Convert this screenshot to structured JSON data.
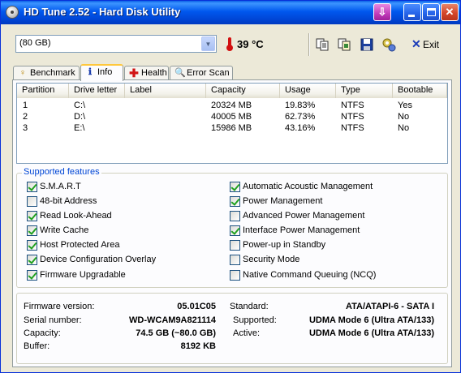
{
  "window": {
    "title": "HD Tune 2.52 - Hard Disk Utility"
  },
  "toolbar": {
    "drive_value": "(80 GB)",
    "temperature": "39 °C",
    "exit_label": "Exit",
    "icons": [
      "copy-text-icon",
      "copy-screenshot-icon",
      "save-icon",
      "options-icon",
      "exit-icon"
    ]
  },
  "tabs": [
    {
      "label": "Benchmark",
      "icon": "benchmark-icon"
    },
    {
      "label": "Info",
      "icon": "info-icon",
      "active": true
    },
    {
      "label": "Health",
      "icon": "health-icon"
    },
    {
      "label": "Error Scan",
      "icon": "error-scan-icon"
    }
  ],
  "partitions": {
    "headers": [
      "Partition",
      "Drive letter",
      "Label",
      "Capacity",
      "Usage",
      "Type",
      "Bootable"
    ],
    "rows": [
      {
        "partition": "1",
        "drive": "C:\\",
        "label": "",
        "capacity": "20324 MB",
        "usage": "19.83%",
        "type": "NTFS",
        "bootable": "Yes"
      },
      {
        "partition": "2",
        "drive": "D:\\",
        "label": "",
        "capacity": "40005 MB",
        "usage": "62.73%",
        "type": "NTFS",
        "bootable": "No"
      },
      {
        "partition": "3",
        "drive": "E:\\",
        "label": "",
        "capacity": "15986 MB",
        "usage": "43.16%",
        "type": "NTFS",
        "bootable": "No"
      }
    ]
  },
  "features": {
    "title": "Supported features",
    "left": [
      {
        "label": "S.M.A.R.T",
        "checked": true
      },
      {
        "label": "48-bit Address",
        "checked": false
      },
      {
        "label": "Read Look-Ahead",
        "checked": true
      },
      {
        "label": "Write Cache",
        "checked": true
      },
      {
        "label": "Host Protected Area",
        "checked": true
      },
      {
        "label": "Device Configuration Overlay",
        "checked": true
      },
      {
        "label": "Firmware Upgradable",
        "checked": true
      }
    ],
    "right": [
      {
        "label": "Automatic Acoustic Management",
        "checked": true
      },
      {
        "label": "Power Management",
        "checked": true
      },
      {
        "label": "Advanced Power Management",
        "checked": false
      },
      {
        "label": "Interface Power Management",
        "checked": true
      },
      {
        "label": "Power-up in Standby",
        "checked": false
      },
      {
        "label": "Security Mode",
        "checked": false
      },
      {
        "label": "Native Command Queuing (NCQ)",
        "checked": false
      }
    ]
  },
  "info": {
    "firmware_label": "Firmware version:",
    "firmware_value": "05.01C05",
    "serial_label": "Serial number:",
    "serial_value": "WD-WCAM9A821114",
    "capacity_label": "Capacity:",
    "capacity_value": "74.5 GB (~80.0 GB)",
    "buffer_label": "Buffer:",
    "buffer_value": "8192 KB",
    "standard_label": "Standard:",
    "standard_value": "ATA/ATAPI-6 - SATA I",
    "supported_label": "Supported:",
    "supported_value": "UDMA Mode 6 (Ultra ATA/133)",
    "active_label": "Active:",
    "active_value": "UDMA Mode 6 (Ultra ATA/133)"
  }
}
